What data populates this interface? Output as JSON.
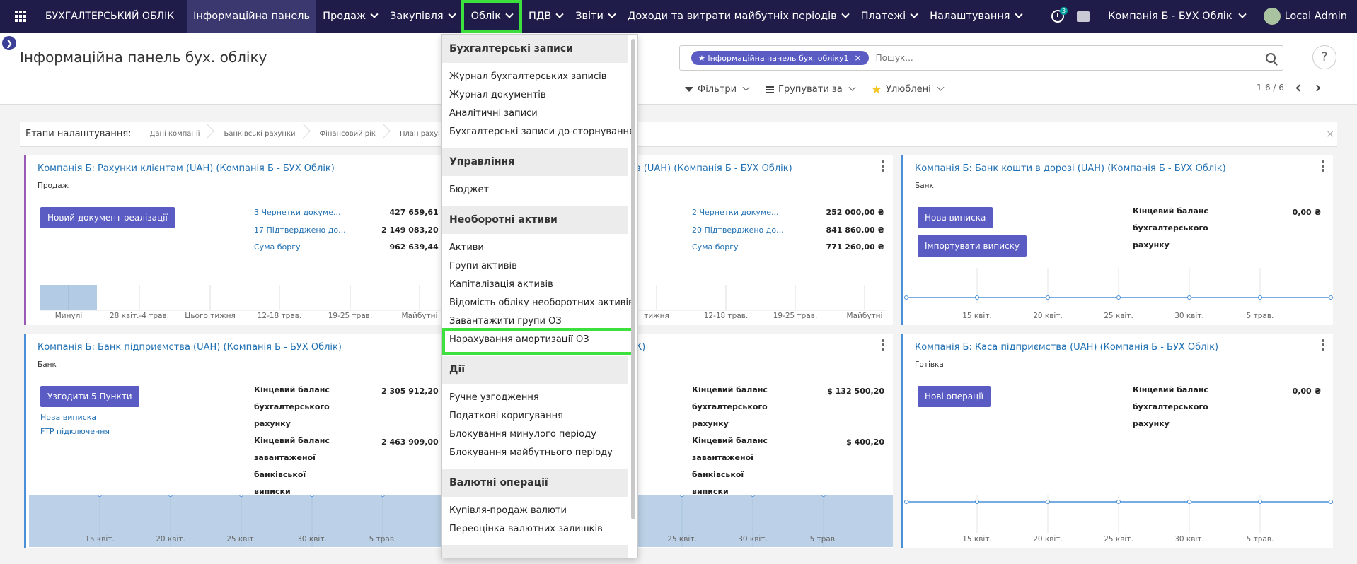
{
  "navbar": {
    "brand": "БУХГАЛТЕРСЬКИЙ ОБЛІК",
    "menu": [
      {
        "label": "Інформаційна панель"
      },
      {
        "label": "Продаж"
      },
      {
        "label": "Закупівля"
      },
      {
        "label": "Облік"
      },
      {
        "label": "ПДВ"
      },
      {
        "label": "Звіти"
      },
      {
        "label": "Доходи та витрати майбутніх періодів"
      },
      {
        "label": "Платежі"
      },
      {
        "label": "Налаштування"
      }
    ],
    "activity_count": "3",
    "company": "Компанія Б - БУХ Облік",
    "user": "Local Admin"
  },
  "control": {
    "title": "Інформаційна панель бух. обліку",
    "facet": "Інформаційна панель бух. обліку1",
    "search_placeholder": "Пошук...",
    "filters_label": "Фільтри",
    "group_label": "Групувати за",
    "favorites_label": "Улюблені",
    "pager": "1-6 / 6"
  },
  "setup": {
    "label": "Етапи налаштування:",
    "steps": [
      "Дані компанії",
      "Банківські рахунки",
      "Фінансовий рік",
      "План рахунків"
    ],
    "close": "×"
  },
  "cards": [
    {
      "title": "Компанія Б: Рахунки клієнтам (UAH) (Компанія Б - БУХ Облік)",
      "type": "Продаж",
      "button": "Новий документ реалізації",
      "stats": [
        {
          "label": "3 Чернетки докуме...",
          "value": "427 659,61 ₴"
        },
        {
          "label": "17 Підтверджено до...",
          "value": "2 149 083,20 ₴"
        },
        {
          "label": "Сума боргу",
          "value": "962 639,44 ₴"
        }
      ],
      "ticks": [
        "Минулі",
        "28 квіт.-4 трав.",
        "Цього тижня",
        "12-18 трав.",
        "19-25 трав.",
        "Майбутні"
      ]
    },
    {
      "title": "Компанія Б: Рахунки постачальників (UAH) (Компанія Б - БУХ Облік)",
      "visible_title": "в (UAH) (Компанія Б - БУХ Облік)",
      "stats": [
        {
          "label": "2 Чернетки докуме...",
          "value": "252 000,00 ₴"
        },
        {
          "label": "20 Підтверджено до...",
          "value": "841 860,00 ₴"
        },
        {
          "label": "Сума боргу",
          "value": "771 260,00 ₴"
        }
      ],
      "ticks": [
        "тижня",
        "12-18 трав.",
        "19-25 трав.",
        "Майбутні"
      ]
    },
    {
      "title": "Компанія Б: Банк кошти в дорозі (UAH) (Компанія Б - БУХ Облік)",
      "type": "Банк",
      "buttons": [
        "Нова виписка",
        "Імпортувати виписку"
      ],
      "balance_label": "Кінцевий баланс бухгалтерського рахунку",
      "balance_value": "0,00 ₴",
      "ticks": [
        "15 квіт.",
        "20 квіт.",
        "25 квіт.",
        "30 квіт.",
        "5 трав."
      ]
    },
    {
      "title": "Компанія Б: Банк підприємства (UAH) (Компанія Б - БУХ Облік)",
      "type": "Банк",
      "button": "Узгодити 5 Пункти",
      "links": [
        "Нова виписка",
        "FTP підключення"
      ],
      "balance1_label": "Кінцевий баланс бухгалтерського рахунку",
      "balance1_value": "2 305 912,20 ₴",
      "balance2_label": "Кінцевий баланс завантаженої банківської виписки",
      "balance2_value": "2 463 909,00 ₴",
      "ticks": [
        "15 квіт.",
        "20 квіт.",
        "25 квіт.",
        "30 квіт.",
        "5 трав."
      ]
    },
    {
      "title": "Компанія Б: Банк (USD) (Компанія Б - БУХ Облік)",
      "visible_title": "К)",
      "balance1_label": "Кінцевий баланс бухгалтерського рахунку",
      "balance1_value": "$ 132 500,20",
      "balance2_label": "Кінцевий баланс завантаженої банківської виписки",
      "balance2_value": "$ 400,20",
      "ticks": [
        "25 квіт.",
        "30 квіт.",
        "5 трав."
      ]
    },
    {
      "title": "Компанія Б: Каса підприємства (UAH) (Компанія Б - БУХ Облік)",
      "type": "Готівка",
      "button": "Нові операції",
      "balance_label": "Кінцевий баланс бухгалтерського рахунку",
      "balance_value": "0,00 ₴",
      "ticks": [
        "15 квіт.",
        "20 квіт.",
        "25 квіт.",
        "30 квіт.",
        "5 трав."
      ]
    }
  ],
  "dropdown": {
    "sections": [
      {
        "header": "Бухгалтерські записи",
        "items": [
          "Журнал бухгалтерських записів",
          "Журнал документів",
          "Аналітичні записи",
          "Бухгалтерські записи до сторнування"
        ]
      },
      {
        "header": "Управління",
        "items": [
          "Бюджет"
        ]
      },
      {
        "header": "Необоротні активи",
        "items": [
          "Активи",
          "Групи активів",
          "Капіталізація активів",
          "Відомість обліку необоротних активів",
          "Завантажити групи ОЗ",
          "Нарахування амортизації ОЗ"
        ]
      },
      {
        "header": "Дії",
        "items": [
          "Ручне узгодження",
          "Податкові коригування",
          "Блокування минулого періоду",
          "Блокування майбутнього періоду"
        ]
      },
      {
        "header": "Валютні операції",
        "items": [
          "Купівля-продаж валюти",
          "Переоцінка валютних залишків"
        ]
      }
    ]
  },
  "colors": {
    "navbar": "#1f1c4a",
    "button": "#5a5cc4",
    "link": "#1f6fb2",
    "highlight": "#3de03d"
  }
}
